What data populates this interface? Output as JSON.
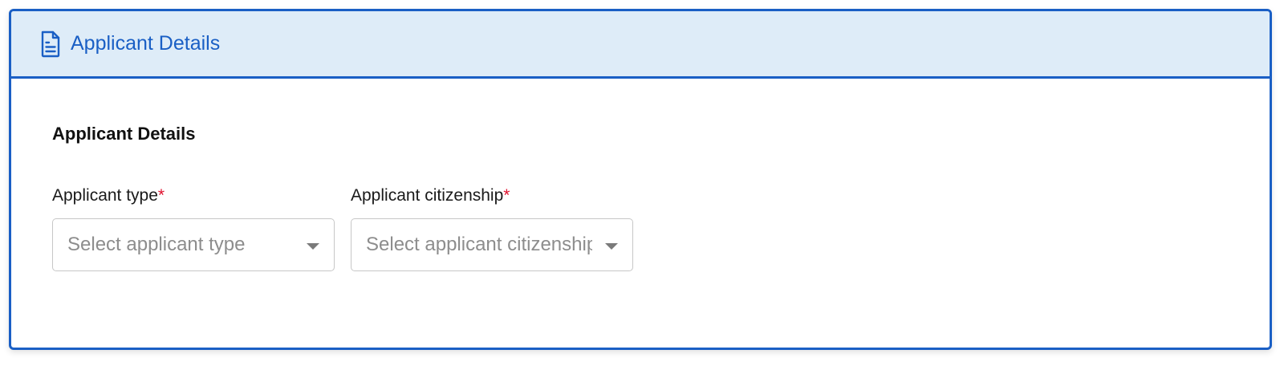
{
  "header": {
    "title": "Applicant Details",
    "icon": "document-icon",
    "accent_color": "#1a5fc5",
    "background_color": "#deecf8"
  },
  "section": {
    "title": "Applicant Details"
  },
  "fields": [
    {
      "label": "Applicant type",
      "required_mark": "*",
      "placeholder": "Select applicant type"
    },
    {
      "label": "Applicant citizenship",
      "required_mark": "*",
      "placeholder": "Select applicant citizenship"
    }
  ]
}
